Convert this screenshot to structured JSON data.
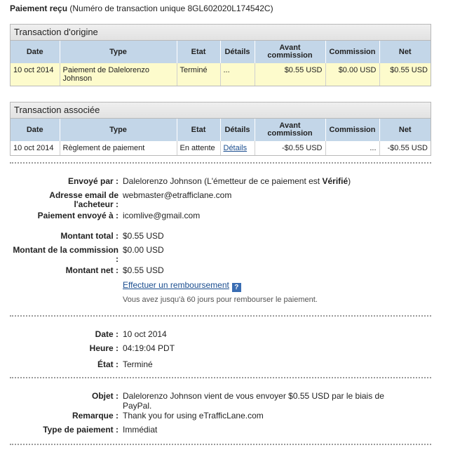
{
  "title": {
    "bold": "Paiement reçu",
    "rest": "(Numéro de transaction unique 8GL602020L174542C)"
  },
  "columns": {
    "date": "Date",
    "type": "Type",
    "etat": "Etat",
    "details": "Détails",
    "avant": "Avant commission",
    "commission": "Commission",
    "net": "Net"
  },
  "origin": {
    "caption": "Transaction d'origine",
    "row": {
      "date": "10 oct 2014",
      "type": "Paiement de Dalelorenzo Johnson",
      "etat": "Terminé",
      "details": "...",
      "avant": "$0.55 USD",
      "commission": "$0.00 USD",
      "net": "$0.55 USD"
    }
  },
  "associated": {
    "caption": "Transaction associée",
    "row": {
      "date": "10 oct 2014",
      "type": "Règlement de paiement",
      "etat": "En attente",
      "details": "Détails",
      "avant": "-$0.55 USD",
      "commission": "...",
      "net": "-$0.55 USD"
    }
  },
  "sender": {
    "envoye_label": "Envoyé par :",
    "envoye_name": "Dalelorenzo Johnson",
    "envoye_note_pre": "(L'émetteur de ce paiement est ",
    "envoye_note_bold": "Vérifié",
    "envoye_note_post": ")",
    "email_label": "Adresse email de l'acheteur :",
    "email_value": "webmaster@etrafficlane.com",
    "to_label": "Paiement envoyé à :",
    "to_value": "icomlive@gmail.com"
  },
  "amounts": {
    "total_label": "Montant total :",
    "total_value": "$0.55 USD",
    "commission_label": "Montant de la commission :",
    "commission_value": "$0.00 USD",
    "net_label": "Montant net :",
    "net_value": "$0.55 USD",
    "refund_link": "Effectuer un remboursement",
    "refund_note": "Vous avez jusqu'à 60 jours pour rembourser le paiement."
  },
  "timing": {
    "date_label": "Date :",
    "date_value": "10 oct 2014",
    "heure_label": "Heure :",
    "heure_value": "04:19:04 PDT",
    "etat_label": "État :",
    "etat_value": "Terminé"
  },
  "message": {
    "objet_label": "Objet :",
    "objet_value": "Dalelorenzo Johnson vient de vous envoyer $0.55 USD par le biais de PayPal.",
    "remarque_label": "Remarque :",
    "remarque_value": "Thank you for using eTrafficLane.com",
    "type_label": "Type de paiement :",
    "type_value": "Immédiat"
  }
}
